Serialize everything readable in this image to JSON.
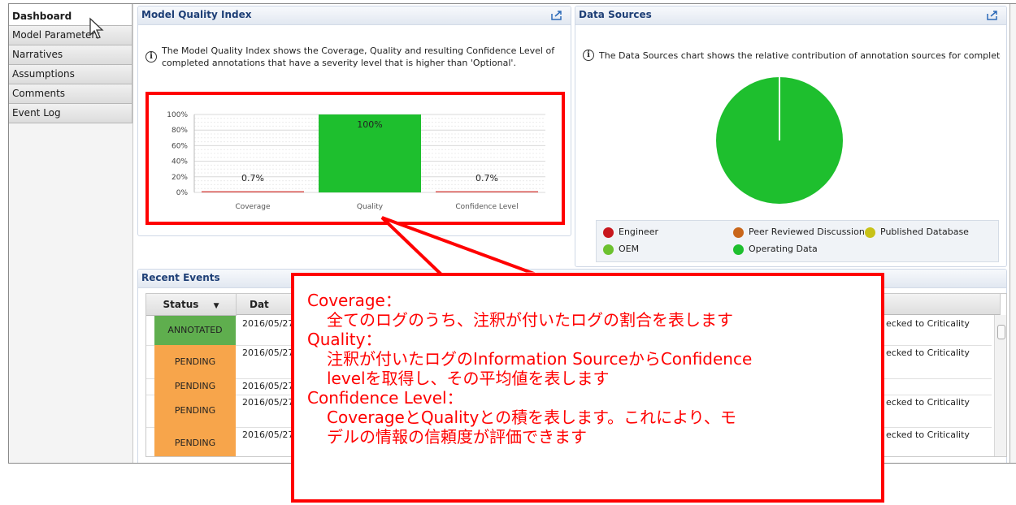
{
  "sidebar": {
    "items": [
      {
        "label": "Dashboard",
        "active": true
      },
      {
        "label": "Model Parameters",
        "active": false
      },
      {
        "label": "Narratives",
        "active": false
      },
      {
        "label": "Assumptions",
        "active": false
      },
      {
        "label": "Comments",
        "active": false
      },
      {
        "label": "Event Log",
        "active": false
      }
    ]
  },
  "model_quality": {
    "title": "Model Quality Index",
    "info": [
      "The Model Quality Index shows the Coverage, Quality and resulting Confidence Level of",
      "completed annotations that have a severity level that is higher than 'Optional'."
    ]
  },
  "data_sources": {
    "title": "Data Sources",
    "info": "The Data Sources chart shows the relative contribution of annotation sources for complete...",
    "legend": [
      {
        "label": "Engineer",
        "color": "#c8171d"
      },
      {
        "label": "Peer Reviewed Discussion",
        "color": "#c9661a"
      },
      {
        "label": "Published Database",
        "color": "#c8c217"
      },
      {
        "label": "OEM",
        "color": "#6cc12f"
      },
      {
        "label": "Operating Data",
        "color": "#1ebf2e"
      }
    ]
  },
  "chart_data": [
    {
      "type": "bar",
      "categories": [
        "Coverage",
        "Quality",
        "Confidence Level"
      ],
      "values": [
        0.7,
        100,
        0.7
      ],
      "data_labels": [
        "0.7%",
        "100%",
        "0.7%"
      ],
      "y_ticks": [
        "100%",
        "80%",
        "60%",
        "40%",
        "20%",
        "0%"
      ],
      "ylim": [
        0,
        100
      ],
      "bar_color": "#1ebf2e",
      "grid": true
    },
    {
      "type": "pie",
      "categories": [
        "Operating Data"
      ],
      "values": [
        100
      ],
      "color": "#1ebf2e"
    }
  ],
  "recent_events": {
    "title": "Recent Events",
    "columns": {
      "status": "Status",
      "date": "Dat",
      "status_sort": "▼"
    },
    "rows": [
      {
        "status": "ANNOTATED",
        "status_color": "#5fae4e",
        "date": "2016/05/27",
        "right": "ecked to Criticality"
      },
      {
        "status": "PENDING",
        "status_color": "#f7a54b",
        "date": "2016/05/27",
        "right": "ecked to Criticality"
      },
      {
        "status": "PENDING",
        "status_color": "#f7a54b",
        "date": "2016/05/27",
        "right": ""
      },
      {
        "status": "PENDING",
        "status_color": "#f7a54b",
        "date": "2016/05/27",
        "right": "ecked to Criticality"
      },
      {
        "status": "PENDING",
        "status_color": "#f7a54b",
        "date": "2016/05/27",
        "right": "ecked to Criticality"
      }
    ]
  },
  "callout": {
    "lines": [
      {
        "text": "Coverage：",
        "indent": false
      },
      {
        "text": "全てのログのうち、注釈が付いたログの割合を表します",
        "indent": true
      },
      {
        "text": "Quality：",
        "indent": false
      },
      {
        "text": "注釈が付いたログのInformation SourceからConfidence",
        "indent": true
      },
      {
        "text": "levelを取得し、その平均値を表します",
        "indent": true
      },
      {
        "text": "Confidence Level：",
        "indent": false
      },
      {
        "text": "CoverageとQualityとの積を表します。これにより、モ",
        "indent": true
      },
      {
        "text": "デルの情報の信頼度が評価できます",
        "indent": true
      }
    ]
  }
}
